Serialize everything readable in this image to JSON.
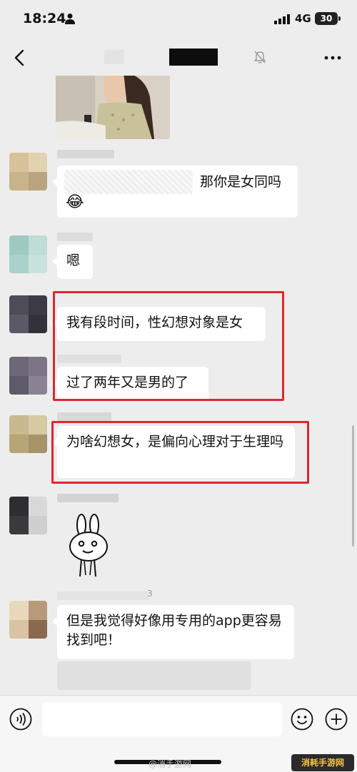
{
  "status_bar": {
    "time": "18:24",
    "network": "4G",
    "battery": "30"
  },
  "nav": {
    "back_icon": "chevron-left-icon",
    "mute_icon": "bell-off-icon",
    "more_icon": "more-dots-icon"
  },
  "messages": [
    {
      "text": "那你是女同吗",
      "emoji": "😂"
    },
    {
      "text": "嗯"
    },
    {
      "text": "我有段时间，性幻想对象是女"
    },
    {
      "text": "过了两年又是男的了"
    },
    {
      "text": "为啥幻想女，是偏向心理对于生理吗"
    },
    {
      "sticker": "rabbit-sticker"
    },
    {
      "text": "但是我觉得好像用专用的app更容易找到吧！"
    }
  ],
  "name_fragment": "3",
  "input_bar": {
    "placeholder": "",
    "voice_icon": "voice-icon",
    "emoji_icon": "emoji-icon",
    "plus_icon": "plus-icon"
  },
  "watermark": {
    "left": "@消手游网",
    "logo": "消耗手游网"
  },
  "colors": {
    "background": "#ededed",
    "highlight": "#e0262d",
    "bubble": "#ffffff"
  }
}
